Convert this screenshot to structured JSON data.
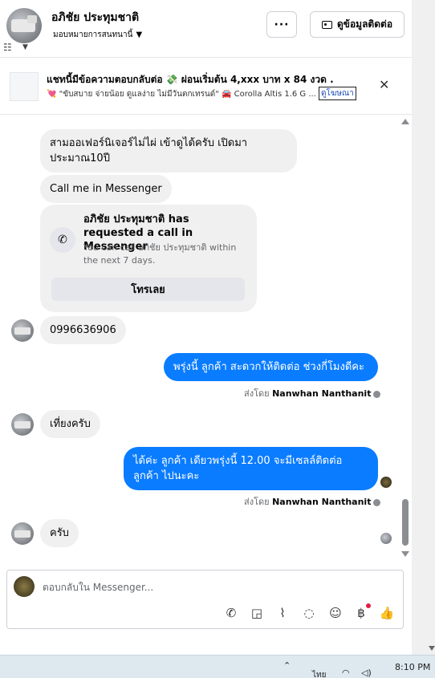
{
  "header": {
    "contact_name": "อภิชัย ประทุมชาติ",
    "assignment": "มอบหมายการสนทนานี้",
    "more_label": "···",
    "contact_info_label": "ดูข้อมูลติดต่อ"
  },
  "ad": {
    "title": "แชทนี้มีข้อความตอบกลับต่อ 💸 ผ่อนเริ่มต้น 4,xxx บาท x 84 งวด .",
    "description": "💘 \"ขับสบาย จ่ายน้อย ดูแลง่าย ไม่มีวันตกเทรนด์\" 🚘 Corolla Altis 1.6 G ...",
    "link_label": "ดูโฆษณา",
    "close_label": "✕"
  },
  "messages": {
    "m1": "สามออเฟอร์นิเจอร์ไม่ไผ่ เข้าดูได้ครับ เปิดมา ประมาณ10ปี",
    "m2": "Call me in Messenger",
    "call_card": {
      "title": "อภิชัย ประทุมชาติ has requested a call in Messenger",
      "subtitle": "You can call อภิชัย ประทุมชาติ within the next 7 days.",
      "button": "โทรเลย"
    },
    "m3": "0996636906",
    "m4": "พรุ่งนี้ ลูกค้า สะดวกให้ติดต่อ ช่วงกี่โมงดีคะ",
    "sent_by_prefix": "ส่งโดย",
    "sent_by_name": "Nanwhan Nanthanit",
    "m5": "เที่ยงครับ",
    "m6": "ได้ค่ะ  ลูกค้า เดียวพรุ่งนี้ 12.00 จะมีเซลล์ติดต่อ ลูกค้า ไปนะคะ",
    "m7": "ครับ"
  },
  "composer": {
    "placeholder": "ตอบกลับใน Messenger..."
  },
  "taskbar": {
    "language": "ไทย",
    "time": "8:10 PM"
  },
  "icons": {
    "tools": [
      "phone-icon",
      "bag-icon",
      "paperclip-icon",
      "chat-bubble-icon",
      "emoji-icon",
      "baht-icon",
      "thumbs-up-icon"
    ]
  },
  "colors": {
    "outgoing_bubble": "#0a7cff",
    "incoming_bubble": "#f0f0f0",
    "link": "#1b4dbb"
  }
}
